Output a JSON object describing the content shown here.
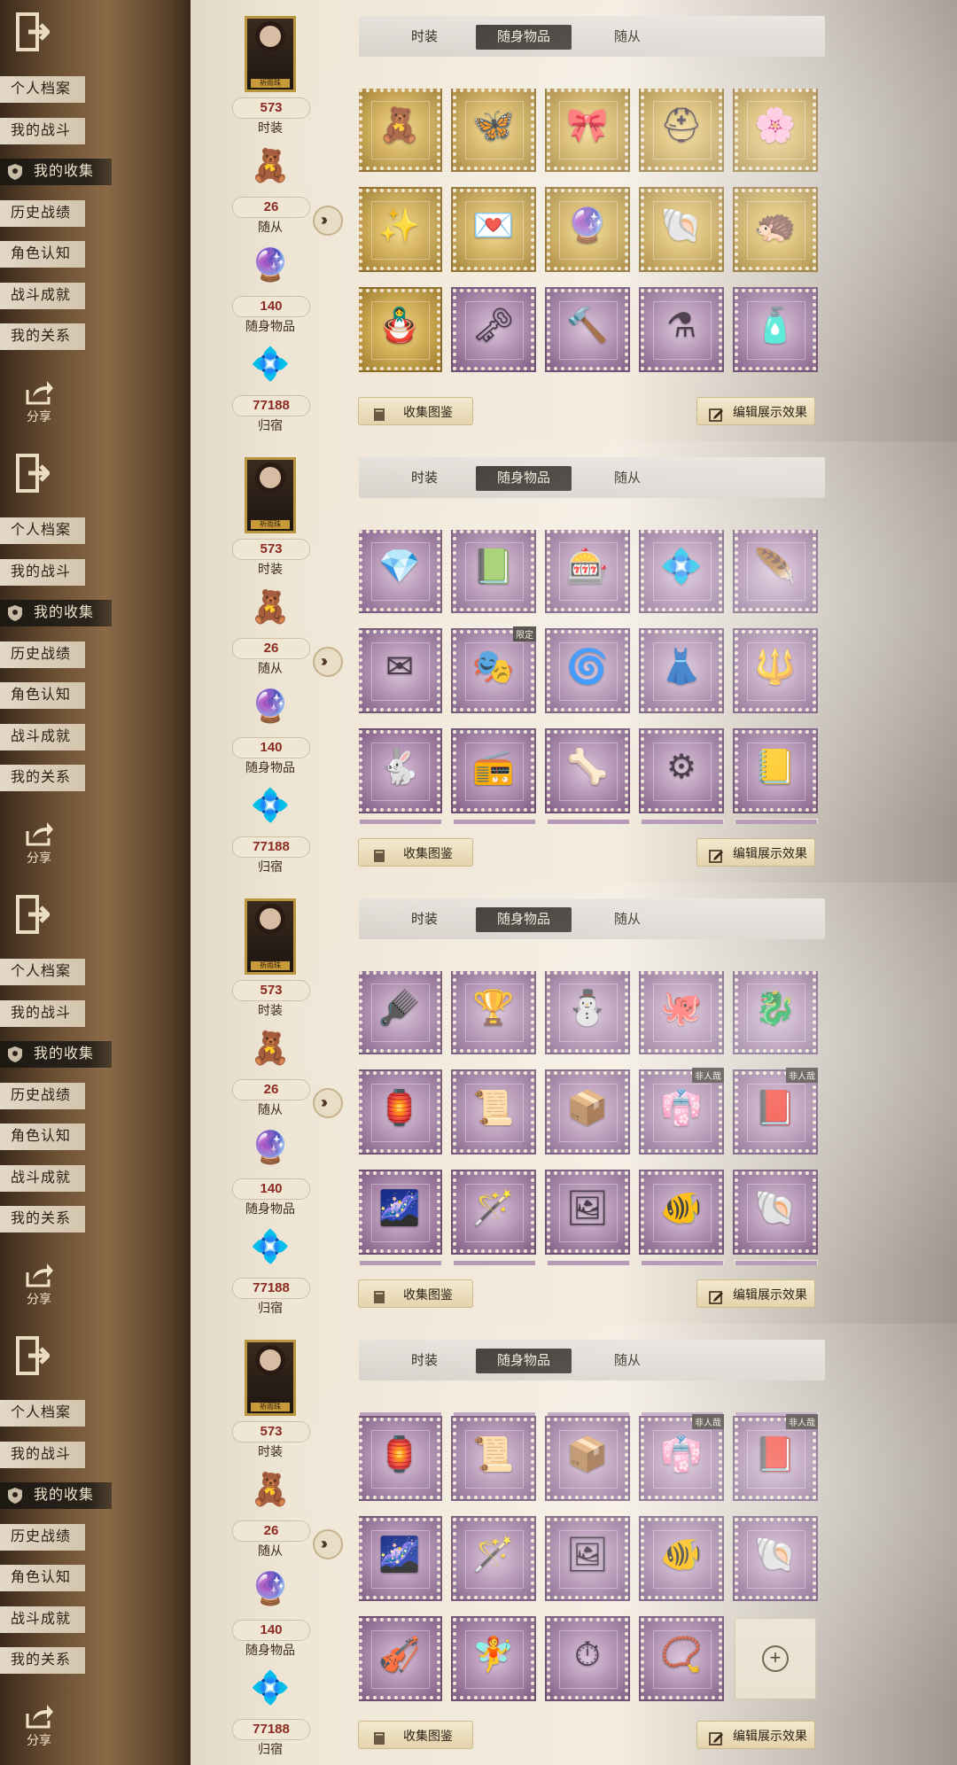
{
  "sidebar": {
    "items": [
      "个人档案",
      "我的战斗",
      "我的收集",
      "历史战绩",
      "角色认知",
      "战斗成就",
      "我的关系"
    ],
    "active_index": 2,
    "share_label": "分享"
  },
  "stats": {
    "portrait_name": "祈雨珠",
    "costume": {
      "count": "573",
      "label": "时装"
    },
    "follower": {
      "count": "26",
      "label": "随从"
    },
    "accessory": {
      "count": "140",
      "label": "随身物品"
    },
    "residence": {
      "count": "77188",
      "label": "归宿"
    }
  },
  "tabs": [
    "时装",
    "随身物品",
    "随从"
  ],
  "active_tab": 1,
  "buttons": {
    "collection_book": "收集图鉴",
    "edit_display": "编辑展示效果"
  },
  "item_badges": {
    "limited": "限定",
    "non_human": "非人哉"
  },
  "panels": [
    {
      "rows": [
        [
          {
            "f": "gold",
            "g": "🧸"
          },
          {
            "f": "gold",
            "g": "🦋"
          },
          {
            "f": "gold",
            "g": "🎀"
          },
          {
            "f": "gold",
            "g": "⛑"
          },
          {
            "f": "gold",
            "g": "🌸"
          }
        ],
        [
          {
            "f": "gold",
            "g": "✨"
          },
          {
            "f": "gold",
            "g": "💌"
          },
          {
            "f": "gold",
            "g": "🔮"
          },
          {
            "f": "gold",
            "g": "🐚"
          },
          {
            "f": "gold",
            "g": "🦔"
          }
        ],
        [
          {
            "f": "gold",
            "g": "🪆"
          },
          {
            "f": "purple",
            "g": "🗝"
          },
          {
            "f": "purple",
            "g": "🔨"
          },
          {
            "f": "purple",
            "g": "⚗"
          },
          {
            "f": "purple",
            "g": "🧴"
          }
        ]
      ],
      "peek": false
    },
    {
      "rows": [
        [
          {
            "f": "purple",
            "g": "💎"
          },
          {
            "f": "purple",
            "g": "📗"
          },
          {
            "f": "purple",
            "g": "🎰"
          },
          {
            "f": "purple",
            "g": "💠"
          },
          {
            "f": "purple",
            "g": "🪶"
          }
        ],
        [
          {
            "f": "purple",
            "g": "✉"
          },
          {
            "f": "purple",
            "g": "🎭",
            "badge": "limited"
          },
          {
            "f": "purple",
            "g": "🌀"
          },
          {
            "f": "purple",
            "g": "👗"
          },
          {
            "f": "purple",
            "g": "🔱"
          }
        ],
        [
          {
            "f": "purple",
            "g": "🐇"
          },
          {
            "f": "purple",
            "g": "📻"
          },
          {
            "f": "purple",
            "g": "🦴"
          },
          {
            "f": "purple",
            "g": "⚙"
          },
          {
            "f": "purple",
            "g": "📒"
          }
        ]
      ],
      "peek": true
    },
    {
      "rows": [
        [
          {
            "f": "purple",
            "g": "🪮"
          },
          {
            "f": "purple",
            "g": "🏆"
          },
          {
            "f": "purple",
            "g": "⛄"
          },
          {
            "f": "purple",
            "g": "🐙"
          },
          {
            "f": "purple",
            "g": "🐉"
          }
        ],
        [
          {
            "f": "purple",
            "g": "🏮"
          },
          {
            "f": "purple",
            "g": "📜"
          },
          {
            "f": "purple",
            "g": "📦"
          },
          {
            "f": "purple",
            "g": "👘",
            "badge": "non_human"
          },
          {
            "f": "purple",
            "g": "📕",
            "badge": "non_human"
          }
        ],
        [
          {
            "f": "purple",
            "g": "🌌"
          },
          {
            "f": "purple",
            "g": "🪄"
          },
          {
            "f": "purple",
            "g": "🖼"
          },
          {
            "f": "purple",
            "g": "🐠"
          },
          {
            "f": "purple",
            "g": "🐚"
          }
        ]
      ],
      "peek": true
    },
    {
      "rows": [
        [
          {
            "f": "purple",
            "g": "🏮"
          },
          {
            "f": "purple",
            "g": "📜"
          },
          {
            "f": "purple",
            "g": "📦"
          },
          {
            "f": "purple",
            "g": "👘",
            "badge": "non_human"
          },
          {
            "f": "purple",
            "g": "📕",
            "badge": "non_human"
          }
        ],
        [
          {
            "f": "purple",
            "g": "🌌"
          },
          {
            "f": "purple",
            "g": "🪄"
          },
          {
            "f": "purple",
            "g": "🖼"
          },
          {
            "f": "purple",
            "g": "🐠"
          },
          {
            "f": "purple",
            "g": "🐚"
          }
        ],
        [
          {
            "f": "purple",
            "g": "🎻"
          },
          {
            "f": "purple",
            "g": "🧚"
          },
          {
            "f": "purple",
            "g": "⏱"
          },
          {
            "f": "purple",
            "g": "📿"
          },
          {
            "f": "empty",
            "g": "+"
          }
        ]
      ],
      "peek": "top"
    }
  ],
  "colors": {
    "gold_frame": "#d4b15a",
    "purple_frame": "#b08fb0",
    "count_red": "#8b2a22",
    "active_dark": "#3b3530"
  }
}
